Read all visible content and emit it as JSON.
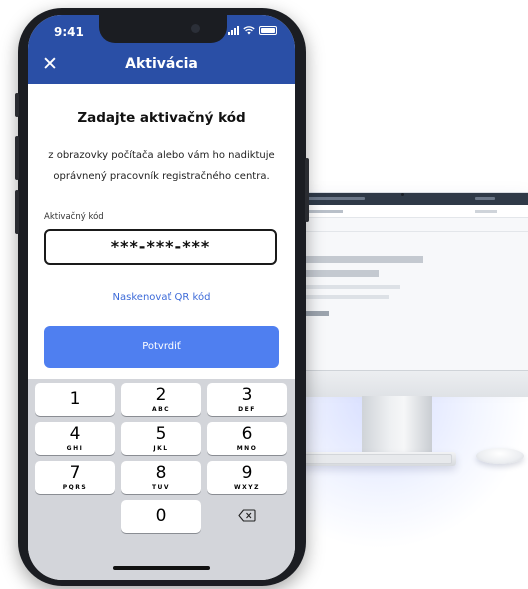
{
  "status": {
    "time": "9:41"
  },
  "header": {
    "title": "Aktivácia",
    "close_icon": "close-icon"
  },
  "content": {
    "heading": "Zadajte aktivačný kód",
    "description": "z obrazovky počítača alebo vám ho nadiktuje oprávnený pracovník registračného centra.",
    "field_label": "Aktivačný kód",
    "code_value": "***-***-***",
    "qr_link": "Naskenovať QR kód",
    "confirm_button": "Potvrdiť"
  },
  "keypad": {
    "keys": [
      {
        "num": "1",
        "letters": ""
      },
      {
        "num": "2",
        "letters": "ABC"
      },
      {
        "num": "3",
        "letters": "DEF"
      },
      {
        "num": "4",
        "letters": "GHI"
      },
      {
        "num": "5",
        "letters": "JKL"
      },
      {
        "num": "6",
        "letters": "MNO"
      },
      {
        "num": "7",
        "letters": "PQRS"
      },
      {
        "num": "8",
        "letters": "TUV"
      },
      {
        "num": "9",
        "letters": "WXYZ"
      },
      {
        "num": "0",
        "letters": ""
      }
    ],
    "delete_icon": "backspace-icon"
  },
  "colors": {
    "header": "#2a4fa6",
    "primary_button": "#4f7ff0",
    "link": "#3c6ad8"
  }
}
